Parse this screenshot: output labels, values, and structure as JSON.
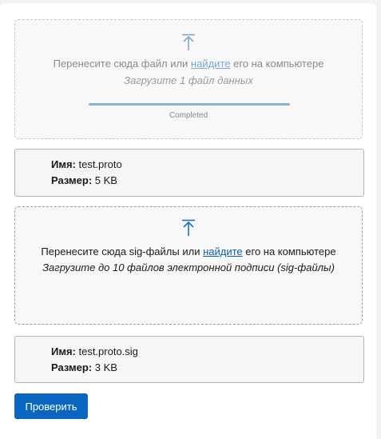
{
  "data_upload": {
    "prompt_before": "Перенесите сюда файл или ",
    "link": "найдите",
    "prompt_after": " его на компьютере",
    "hint": "Загрузите 1 файл данных",
    "progress_percent": 100,
    "progress_label": "Completed"
  },
  "data_file": {
    "name_key": "Имя:",
    "name_value": " test.proto",
    "size_key": "Размер:",
    "size_value": " 5 KB"
  },
  "sig_upload": {
    "prompt_before": "Перенесите сюда sig-файлы или ",
    "link": "найдите",
    "prompt_after": " его на компьютере",
    "hint": "Загрузите до 10 файлов электронной подписи (sig-файлы)"
  },
  "sig_file": {
    "name_key": "Имя:",
    "name_value": " test.proto.sig",
    "size_key": "Размер:",
    "size_value": " 3 KB"
  },
  "actions": {
    "check_label": "Проверить"
  },
  "colors": {
    "accent": "#0b66c2",
    "link": "#0f5fb5",
    "progress": "#8cb2d8"
  },
  "icons": {
    "upload": "upload-arrow-icon"
  }
}
